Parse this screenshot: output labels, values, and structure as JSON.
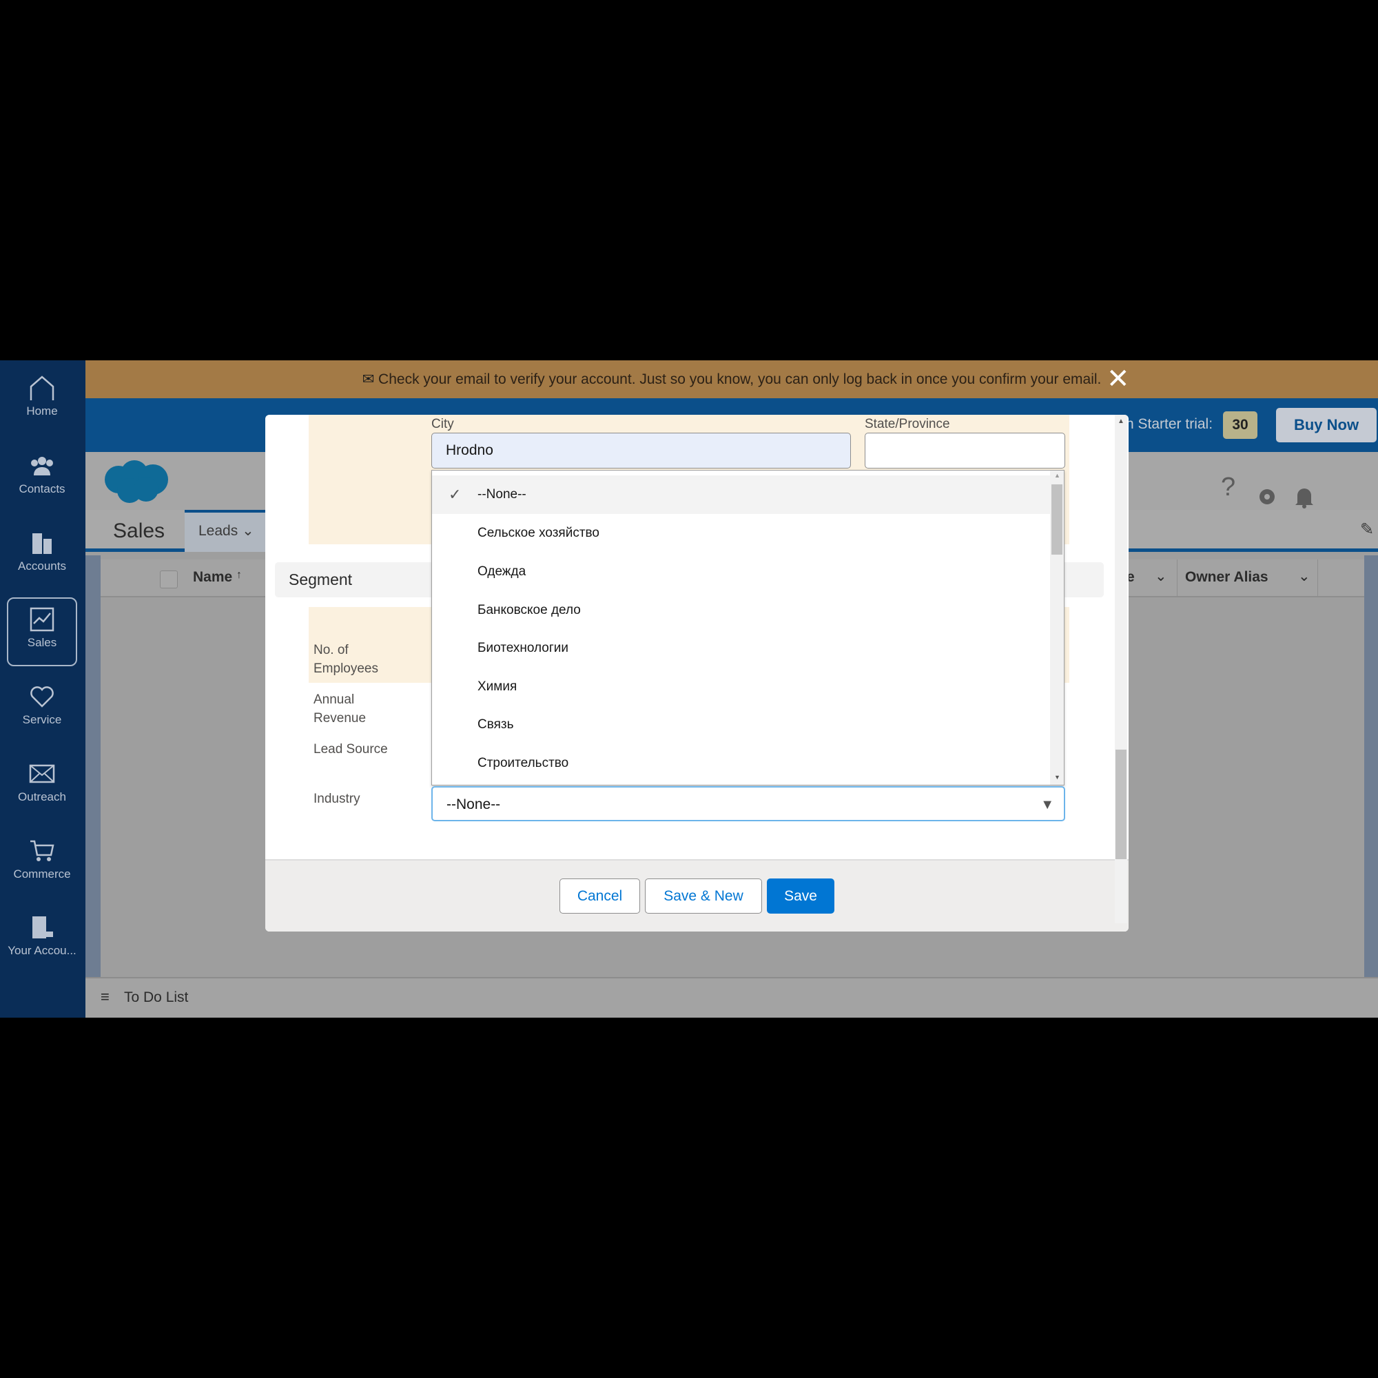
{
  "banner": {
    "text": "Check your email to verify your account. Just so you know, you can only log back in once you confirm your email.",
    "icon": "envelope-icon"
  },
  "sidebar": {
    "items": [
      {
        "label": "Home",
        "icon": "home-icon"
      },
      {
        "label": "Contacts",
        "icon": "contacts-icon"
      },
      {
        "label": "Accounts",
        "icon": "accounts-icon"
      },
      {
        "label": "Sales",
        "icon": "sales-icon",
        "active": true
      },
      {
        "label": "Service",
        "icon": "heart-icon"
      },
      {
        "label": "Outreach",
        "icon": "envelope-icon"
      },
      {
        "label": "Commerce",
        "icon": "cart-icon"
      },
      {
        "label": "Your Accou..."
      }
    ]
  },
  "topbar": {
    "trial_text": "n Starter trial:",
    "trial_days": "30",
    "buy_now": "Buy Now"
  },
  "app": {
    "name": "Sales",
    "tab": "Leads"
  },
  "table": {
    "columns": [
      "Name",
      "e",
      "Owner Alias"
    ],
    "sort_indicator": "↑"
  },
  "todo": {
    "label": "To Do List"
  },
  "modal": {
    "city_label": "City",
    "city_value": "Hrodno",
    "state_label": "State/Province",
    "state_value": "",
    "section": "Segment",
    "labels": {
      "employees_1": "No. of",
      "employees_2": "Employees",
      "revenue_1": "Annual",
      "revenue_2": "Revenue",
      "lead_source": "Lead Source",
      "industry": "Industry"
    },
    "industry_value": "--None--",
    "options": [
      "--None--",
      "Сельское хозяйство",
      "Одежда",
      "Банковское дело",
      "Биотехнологии",
      "Химия",
      "Связь",
      "Строительство"
    ],
    "selected_option": "--None--",
    "buttons": {
      "cancel": "Cancel",
      "save_new": "Save & New",
      "save": "Save"
    }
  },
  "colors": {
    "brand_blue": "#0176d3",
    "sidebar": "#0a2d57",
    "banner": "#a37a46"
  }
}
